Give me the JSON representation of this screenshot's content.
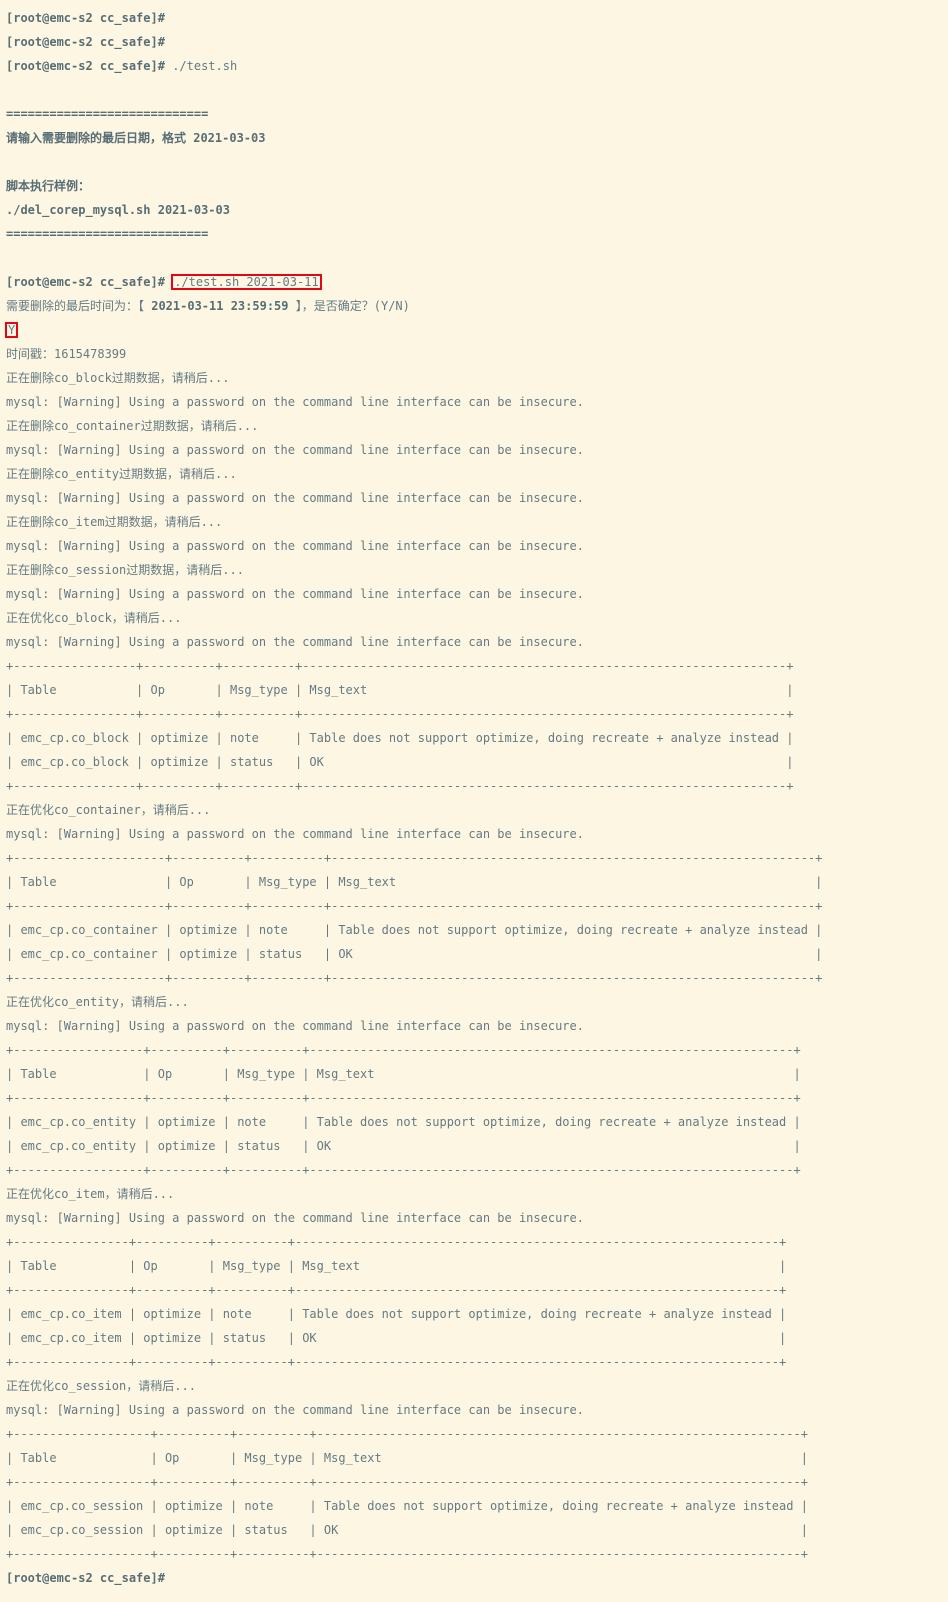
{
  "prompt": "[root@emc-s2 cc_safe]#",
  "cmd1": "./test.sh",
  "divider": "============================",
  "usage1": "请输入需要删除的最后日期，格式 2021-03-03",
  "usage2": "脚本执行样例：",
  "usage3": "./del_corep_mysql.sh 2021-03-03",
  "cmd2": "./test.sh 2021-03-11",
  "need_del_prefix": "需要删除的最后时间为：【 ",
  "need_del_time": "2021-03-11 23:59:59",
  "need_del_suffix": " 】，是否确定？(Y/N)",
  "confirm": "Y",
  "ts": "时间戳：1615478399",
  "del_block": "正在删除co_block过期数据，请稍后...",
  "del_container": "正在删除co_container过期数据，请稍后...",
  "del_entity": "正在删除co_entity过期数据，请稍后...",
  "del_item": "正在删除co_item过期数据，请稍后...",
  "del_session": "正在删除co_session过期数据，请稍后...",
  "warn": "mysql: [Warning] Using a password on the command line interface can be insecure.",
  "opt_block": "正在优化co_block，请稍后...",
  "opt_container": "正在优化co_container，请稍后...",
  "opt_entity": "正在优化co_entity，请稍后...",
  "opt_item": "正在优化co_item，请稍后...",
  "opt_session": "正在优化co_session，请稍后...",
  "tbl_block": {
    "sep": "+-----------------+----------+----------+-------------------------------------------------------------------+",
    "hdr": "| Table           | Op       | Msg_type | Msg_text                                                          |",
    "r1": "| emc_cp.co_block | optimize | note     | Table does not support optimize, doing recreate + analyze instead |",
    "r2": "| emc_cp.co_block | optimize | status   | OK                                                                |"
  },
  "tbl_container": {
    "sep": "+---------------------+----------+----------+-------------------------------------------------------------------+",
    "hdr": "| Table               | Op       | Msg_type | Msg_text                                                          |",
    "r1": "| emc_cp.co_container | optimize | note     | Table does not support optimize, doing recreate + analyze instead |",
    "r2": "| emc_cp.co_container | optimize | status   | OK                                                                |"
  },
  "tbl_entity": {
    "sep": "+------------------+----------+----------+-------------------------------------------------------------------+",
    "hdr": "| Table            | Op       | Msg_type | Msg_text                                                          |",
    "r1": "| emc_cp.co_entity | optimize | note     | Table does not support optimize, doing recreate + analyze instead |",
    "r2": "| emc_cp.co_entity | optimize | status   | OK                                                                |"
  },
  "tbl_item": {
    "sep": "+----------------+----------+----------+-------------------------------------------------------------------+",
    "hdr": "| Table          | Op       | Msg_type | Msg_text                                                          |",
    "r1": "| emc_cp.co_item | optimize | note     | Table does not support optimize, doing recreate + analyze instead |",
    "r2": "| emc_cp.co_item | optimize | status   | OK                                                                |"
  },
  "tbl_session": {
    "sep": "+-------------------+----------+----------+-------------------------------------------------------------------+",
    "hdr": "| Table             | Op       | Msg_type | Msg_text                                                          |",
    "r1": "| emc_cp.co_session | optimize | note     | Table does not support optimize, doing recreate + analyze instead |",
    "r2": "| emc_cp.co_session | optimize | status   | OK                                                                |"
  }
}
